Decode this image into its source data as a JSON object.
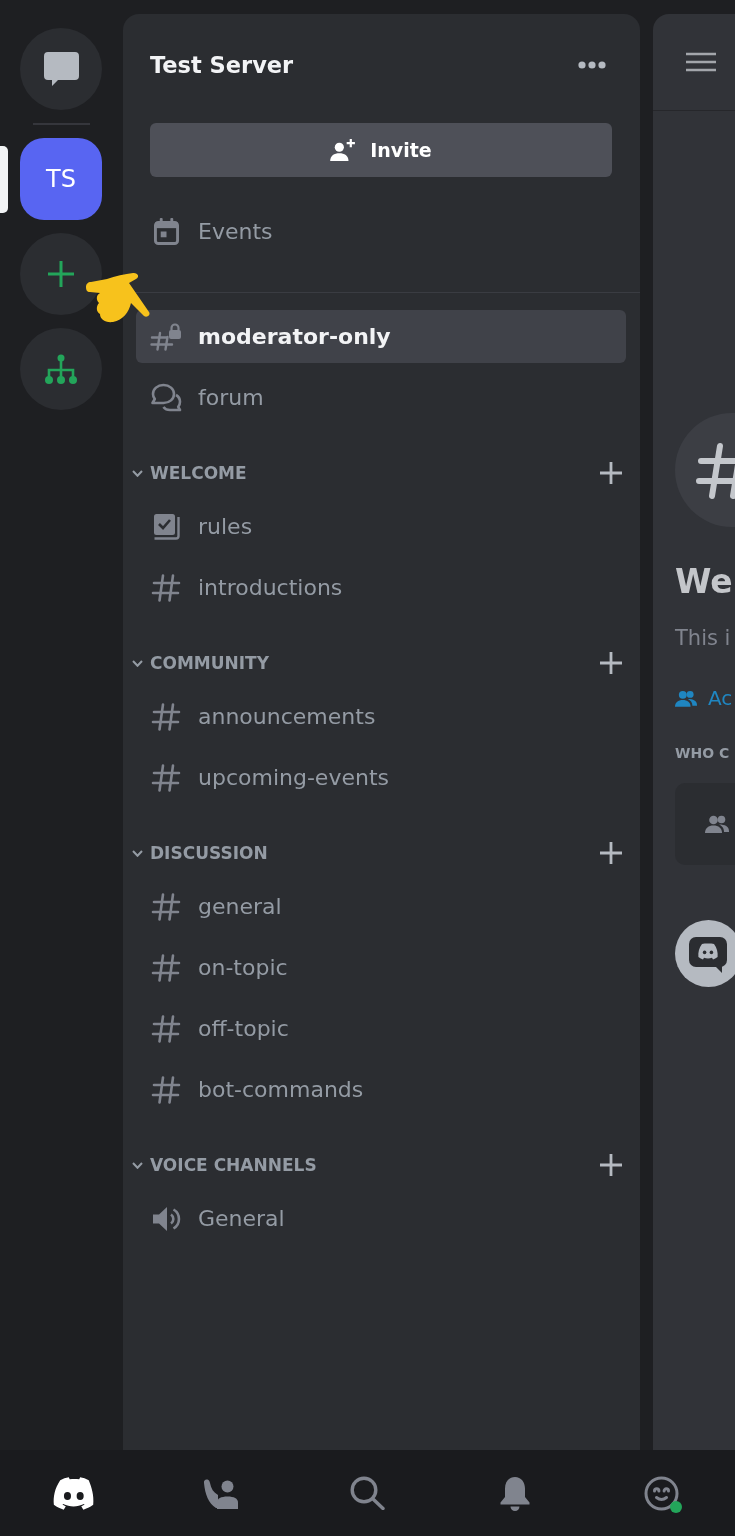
{
  "server_rail": {
    "items": [
      {
        "kind": "direct_messages",
        "selected": false
      },
      {
        "kind": "server",
        "label": "TS",
        "selected": true
      },
      {
        "kind": "add_server",
        "selected": false
      },
      {
        "kind": "discover",
        "selected": false
      }
    ]
  },
  "channel_panel": {
    "server_name": "Test Server",
    "invite_button": "Invite",
    "events": "Events",
    "channels": [
      {
        "kind": "locked_text",
        "name": "moderator-only",
        "selected": true
      },
      {
        "kind": "forum",
        "name": "forum",
        "selected": false
      }
    ],
    "categories": [
      {
        "name": "WELCOME",
        "expanded": true,
        "channels": [
          {
            "kind": "rules",
            "name": "rules",
            "selected": false
          },
          {
            "kind": "text",
            "name": "introductions",
            "selected": false
          }
        ]
      },
      {
        "name": "COMMUNITY",
        "expanded": true,
        "channels": [
          {
            "kind": "text",
            "name": "announcements",
            "selected": false
          },
          {
            "kind": "text",
            "name": "upcoming-events",
            "selected": false
          }
        ]
      },
      {
        "name": "DISCUSSION",
        "expanded": true,
        "channels": [
          {
            "kind": "text",
            "name": "general",
            "selected": false
          },
          {
            "kind": "text",
            "name": "on-topic",
            "selected": false
          },
          {
            "kind": "text",
            "name": "off-topic",
            "selected": false
          },
          {
            "kind": "text",
            "name": "bot-commands",
            "selected": false
          }
        ]
      },
      {
        "name": "VOICE CHANNELS",
        "expanded": true,
        "channels": [
          {
            "kind": "voice",
            "name": "General",
            "selected": false
          }
        ]
      }
    ]
  },
  "chat_panel": {
    "title": "We",
    "description": "This i",
    "link": "Ac",
    "section_heading": "WHO C"
  },
  "bottom_nav": {
    "tabs": [
      {
        "kind": "home",
        "selected": true
      },
      {
        "kind": "friends",
        "selected": false
      },
      {
        "kind": "search",
        "selected": false
      },
      {
        "kind": "notifications",
        "selected": false
      },
      {
        "kind": "profile",
        "selected": false,
        "online": true
      }
    ]
  }
}
